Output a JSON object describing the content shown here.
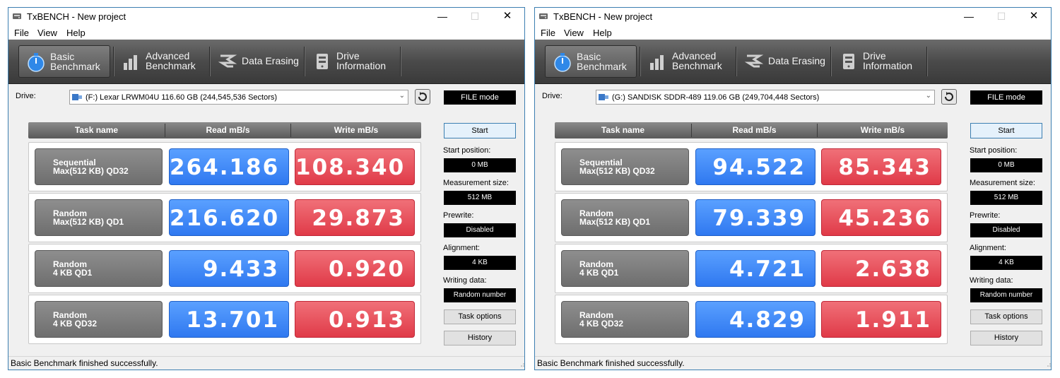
{
  "windows": [
    {
      "title": "TxBENCH - New project",
      "menu": [
        "File",
        "View",
        "Help"
      ],
      "tabs": [
        {
          "line1": "Basic",
          "line2": "Benchmark",
          "icon": "stopwatch-icon"
        },
        {
          "line1": "Advanced",
          "line2": "Benchmark",
          "icon": "bar-chart-icon"
        },
        {
          "line1": "Data Erasing",
          "line2": "",
          "icon": "eraser-icon"
        },
        {
          "line1": "Drive",
          "line2": "Information",
          "icon": "drive-info-icon"
        }
      ],
      "drive_label": "Drive:",
      "drive_value": "(F:) Lexar LRWM04U  116.60 GB (244,545,536 Sectors)",
      "mode": "FILE mode",
      "headers": {
        "task": "Task name",
        "read": "Read mB/s",
        "write": "Write mB/s"
      },
      "rows": [
        {
          "line1": "Sequential",
          "line2": "Max(512 KB) QD32",
          "read": "264.186",
          "write": "108.340"
        },
        {
          "line1": "Random",
          "line2": "Max(512 KB) QD1",
          "read": "216.620",
          "write": "29.873"
        },
        {
          "line1": "Random",
          "line2": "4 KB QD1",
          "read": "9.433",
          "write": "0.920"
        },
        {
          "line1": "Random",
          "line2": "4 KB QD32",
          "read": "13.701",
          "write": "0.913"
        }
      ],
      "start_label": "Start",
      "params": [
        {
          "label": "Start position:",
          "value": "0 MB"
        },
        {
          "label": "Measurement size:",
          "value": "512 MB"
        },
        {
          "label": "Prewrite:",
          "value": "Disabled"
        },
        {
          "label": "Alignment:",
          "value": "4 KB"
        },
        {
          "label": "Writing data:",
          "value": "Random number"
        }
      ],
      "task_options_label": "Task options",
      "history_label": "History",
      "status": "Basic Benchmark finished successfully."
    },
    {
      "title": "TxBENCH - New project",
      "menu": [
        "File",
        "View",
        "Help"
      ],
      "tabs": [
        {
          "line1": "Basic",
          "line2": "Benchmark",
          "icon": "stopwatch-icon"
        },
        {
          "line1": "Advanced",
          "line2": "Benchmark",
          "icon": "bar-chart-icon"
        },
        {
          "line1": "Data Erasing",
          "line2": "",
          "icon": "eraser-icon"
        },
        {
          "line1": "Drive",
          "line2": "Information",
          "icon": "drive-info-icon"
        }
      ],
      "drive_label": "Drive:",
      "drive_value": "(G:) SANDISK SDDR-489  119.06 GB (249,704,448 Sectors)",
      "mode": "FILE mode",
      "headers": {
        "task": "Task name",
        "read": "Read mB/s",
        "write": "Write mB/s"
      },
      "rows": [
        {
          "line1": "Sequential",
          "line2": "Max(512 KB) QD32",
          "read": "94.522",
          "write": "85.343"
        },
        {
          "line1": "Random",
          "line2": "Max(512 KB) QD1",
          "read": "79.339",
          "write": "45.236"
        },
        {
          "line1": "Random",
          "line2": "4 KB QD1",
          "read": "4.721",
          "write": "2.638"
        },
        {
          "line1": "Random",
          "line2": "4 KB QD32",
          "read": "4.829",
          "write": "1.911"
        }
      ],
      "start_label": "Start",
      "params": [
        {
          "label": "Start position:",
          "value": "0 MB"
        },
        {
          "label": "Measurement size:",
          "value": "512 MB"
        },
        {
          "label": "Prewrite:",
          "value": "Disabled"
        },
        {
          "label": "Alignment:",
          "value": "4 KB"
        },
        {
          "label": "Writing data:",
          "value": "Random number"
        }
      ],
      "task_options_label": "Task options",
      "history_label": "History",
      "status": "Basic Benchmark finished successfully."
    }
  ],
  "colors": {
    "read": "#3d86f6",
    "write": "#e84c58",
    "toolbar": "#4a4a4a",
    "window_border": "#3c7fb1"
  }
}
